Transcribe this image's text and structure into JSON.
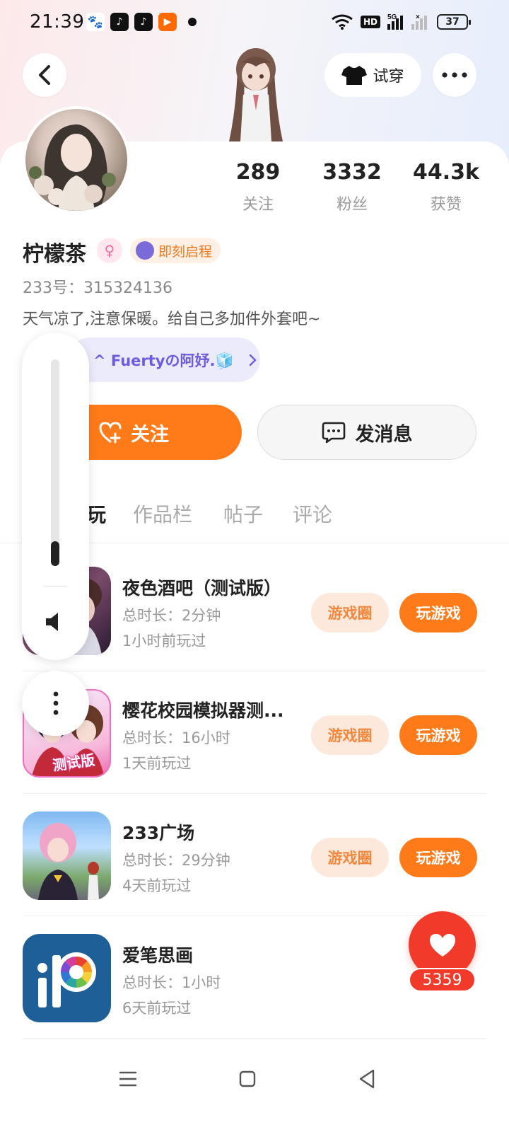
{
  "status_bar": {
    "time": "21:39",
    "network": "5G",
    "hd": "HD",
    "battery": "37"
  },
  "header": {
    "try_on_label": "试穿"
  },
  "profile": {
    "name": "柠檬茶",
    "tag_label": "即刻启程",
    "uid": "233号：315324136",
    "bio": "天气凉了,注意保暖。给自己多加件外套吧~",
    "friend_label": "^ Fuertyの阿妤.🧊",
    "stats": [
      {
        "num": "289",
        "label": "关注"
      },
      {
        "num": "3332",
        "label": "粉丝"
      },
      {
        "num": "44.3k",
        "label": "获赞"
      }
    ],
    "follow_label": "关注",
    "message_label": "发消息"
  },
  "tabs": [
    "玩",
    "作品栏",
    "帖子",
    "评论"
  ],
  "games": [
    {
      "title": "夜色酒吧（测试版）",
      "duration": "总时长：2分钟",
      "last_played": "1小时前玩过",
      "circle_label": "游戏圈",
      "play_label": "玩游戏"
    },
    {
      "title": "樱花校园模拟器测...",
      "duration": "总时长：16小时",
      "last_played": "1天前玩过",
      "circle_label": "游戏圈",
      "play_label": "玩游戏",
      "icon_text": "测试版"
    },
    {
      "title": "233广场",
      "duration": "总时长：29分钟",
      "last_played": "4天前玩过",
      "circle_label": "游戏圈",
      "play_label": "玩游戏"
    },
    {
      "title": "爱笔思画",
      "duration": "总时长：1小时",
      "last_played": "6天前玩过"
    }
  ],
  "like": {
    "count": "5359"
  },
  "volume": {
    "level": 0.12
  },
  "colors": {
    "accent": "#ff7a18",
    "like_red": "#f23a2a",
    "friend_purple": "#6c5ce0"
  }
}
